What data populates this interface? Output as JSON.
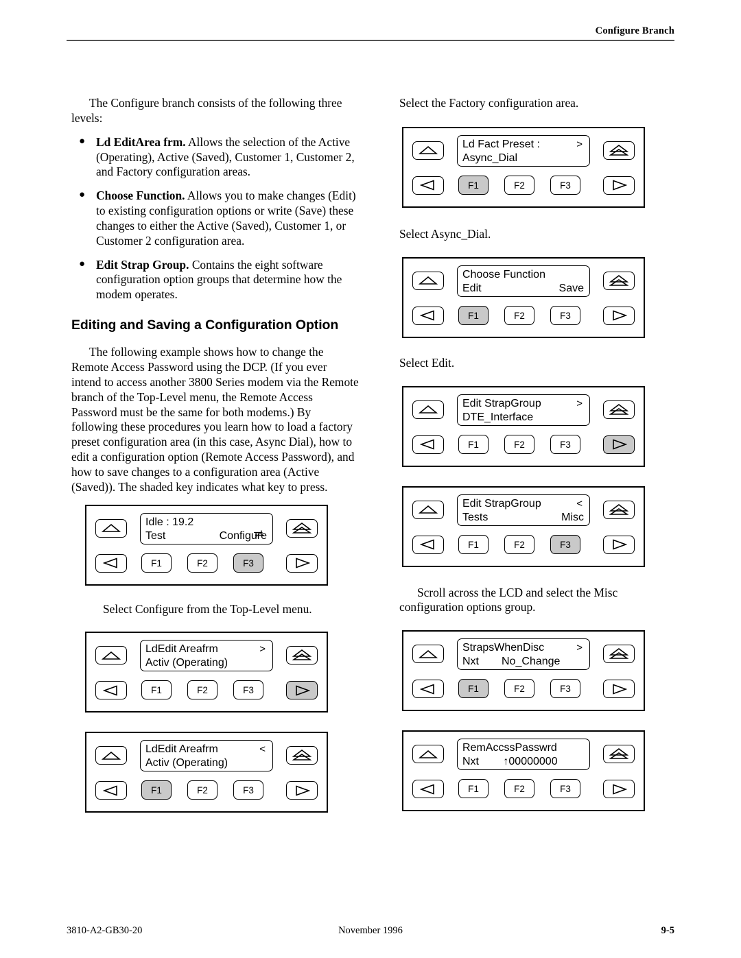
{
  "header": {
    "running_head": "Configure Branch"
  },
  "left_column": {
    "intro": "The Configure branch consists of the following three levels:",
    "bullets": [
      {
        "term": "Ld EditArea frm.",
        "text": " Allows the selection of the Active (Operating), Active (Saved), Customer 1, Customer 2, and Factory configuration areas."
      },
      {
        "term": "Choose Function.",
        "text": " Allows you to make changes (Edit) to existing configuration options or write (Save) these changes to either the Active (Saved), Customer 1, or Customer 2 configuration area."
      },
      {
        "term": "Edit Strap Group.",
        "text": " Contains the eight software configuration option groups that determine how the modem operates."
      }
    ],
    "heading": "Editing and Saving a Configuration Option",
    "paragraph": "The following example shows how to change the Remote Access Password using the DCP. (If you ever intend to access another 3800 Series modem via the Remote branch of the Top-Level menu, the Remote Access Password must be the same for both modems.) By following these procedures you learn how to load a factory preset configuration area (in this case, Async Dial), how to edit a configuration option (Remote Access Password), and how to save changes to a configuration area (Active (Saved)). The shaded key indicates what key to press.",
    "caption_after_panel1": "Select Configure from the Top-Level menu."
  },
  "right_column": {
    "caption_before_panel1": "Select the Factory configuration area.",
    "caption_after_panel1": "Select Async_Dial.",
    "caption_after_panel2": "Select Edit.",
    "caption_after_panel4": "Scroll across the LCD and select the Misc configuration options group."
  },
  "panels": {
    "left": [
      {
        "id": "panel-idle",
        "lcd": {
          "line1_left": "Idle : 19.2",
          "line1_marker": "",
          "line1_swap": true,
          "line2_left": "Test",
          "line2_right": "Configure"
        },
        "keys": {
          "up": "up-arrow-key",
          "top": "top-arrow-key",
          "left": "left-arrow-key",
          "right": "right-arrow-key",
          "f1": "F1",
          "f2": "F2",
          "f3": "F3"
        },
        "shaded": "f3"
      },
      {
        "id": "panel-ldedit-next",
        "lcd": {
          "line1_left": "LdEdit Areafrm",
          "line1_marker": ">",
          "line1_swap": false,
          "line2_left": "Activ (Operating)",
          "line2_right": ""
        },
        "keys": {
          "up": "up-arrow-key",
          "top": "top-arrow-key",
          "left": "left-arrow-key",
          "right": "right-arrow-key",
          "f1": "F1",
          "f2": "F2",
          "f3": "F3"
        },
        "shaded": "right"
      },
      {
        "id": "panel-ldedit-select",
        "lcd": {
          "line1_left": "LdEdit Areafrm",
          "line1_marker": "<",
          "line1_swap": false,
          "line2_left": "Activ (Operating)",
          "line2_right": ""
        },
        "keys": {
          "up": "up-arrow-key",
          "top": "top-arrow-key",
          "left": "left-arrow-key",
          "right": "right-arrow-key",
          "f1": "F1",
          "f2": "F2",
          "f3": "F3"
        },
        "shaded": "f1"
      }
    ],
    "right": [
      {
        "id": "panel-ld-fact-preset",
        "lcd": {
          "line1_left": "Ld Fact Preset :",
          "line1_marker": ">",
          "line1_swap": false,
          "line2_left": "Async_Dial",
          "line2_right": ""
        },
        "keys": {
          "up": "up-arrow-key",
          "top": "top-arrow-key",
          "left": "left-arrow-key",
          "right": "right-arrow-key",
          "f1": "F1",
          "f2": "F2",
          "f3": "F3"
        },
        "shaded": "f1"
      },
      {
        "id": "panel-choose-function",
        "lcd": {
          "line1_left": "Choose Function",
          "line1_marker": "",
          "line1_swap": false,
          "line2_left": "Edit",
          "line2_right": "Save"
        },
        "keys": {
          "up": "up-arrow-key",
          "top": "top-arrow-key",
          "left": "left-arrow-key",
          "right": "right-arrow-key",
          "f1": "F1",
          "f2": "F2",
          "f3": "F3"
        },
        "shaded": "f1"
      },
      {
        "id": "panel-edit-strapgroup-dte",
        "lcd": {
          "line1_left": "Edit StrapGroup",
          "line1_marker": ">",
          "line1_swap": false,
          "line2_left": "DTE_Interface",
          "line2_right": ""
        },
        "keys": {
          "up": "up-arrow-key",
          "top": "top-arrow-key",
          "left": "left-arrow-key",
          "right": "right-arrow-key",
          "f1": "F1",
          "f2": "F2",
          "f3": "F3"
        },
        "shaded": "right"
      },
      {
        "id": "panel-edit-strapgroup-misc",
        "lcd": {
          "line1_left": "Edit StrapGroup",
          "line1_marker": "<",
          "line1_swap": false,
          "line2_left": "Tests",
          "line2_right": "Misc"
        },
        "keys": {
          "up": "up-arrow-key",
          "top": "top-arrow-key",
          "left": "left-arrow-key",
          "right": "right-arrow-key",
          "f1": "F1",
          "f2": "F2",
          "f3": "F3"
        },
        "shaded": "f3"
      },
      {
        "id": "panel-straps-when-disc",
        "lcd": {
          "line1_left": "StrapsWhenDisc",
          "line1_marker": ">",
          "line1_swap": false,
          "line2_left": "Nxt",
          "line2_right": "No_Change"
        },
        "keys": {
          "up": "up-arrow-key",
          "top": "top-arrow-key",
          "left": "left-arrow-key",
          "right": "right-arrow-key",
          "f1": "F1",
          "f2": "F2",
          "f3": "F3"
        },
        "shaded": "f1"
      },
      {
        "id": "panel-rem-accss-passwrd",
        "lcd": {
          "line1_left": "RemAccssPasswrd",
          "line1_marker": "",
          "line1_swap": false,
          "line2_left": "Nxt",
          "line2_right": "↑00000000"
        },
        "keys": {
          "up": "up-arrow-key",
          "top": "top-arrow-key",
          "left": "left-arrow-key",
          "right": "right-arrow-key",
          "f1": "F1",
          "f2": "F2",
          "f3": "F3"
        },
        "shaded": "none"
      }
    ]
  },
  "footer": {
    "document_number": "3810-A2-GB30-20",
    "date": "November 1996",
    "page_number": "9-5"
  },
  "colors": {
    "shaded_key": "#c9c9c9",
    "rule": "#555555",
    "text": "#000000"
  }
}
